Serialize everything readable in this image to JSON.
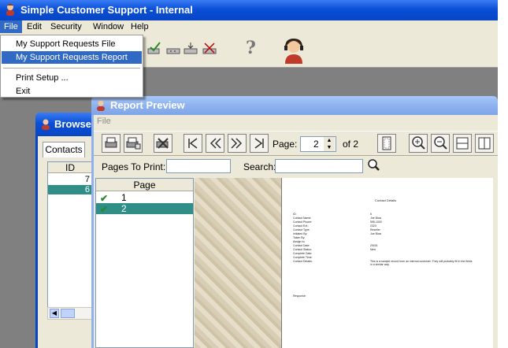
{
  "main_window": {
    "title": "Simple Customer Support - Internal"
  },
  "menubar": {
    "items": [
      "File",
      "Edit",
      "Security",
      "Window",
      "Help"
    ]
  },
  "file_menu": {
    "items": [
      "My Support Requests File",
      "My Support Requests Report",
      "Print Setup ...",
      "Exit"
    ],
    "selected": "My Support Requests Report"
  },
  "toolbar": {
    "help_glyph": "?"
  },
  "browse_window": {
    "title": "Browse",
    "tab": "Contacts",
    "column_header": "ID",
    "rows": [
      "7",
      "6"
    ],
    "selected_row": "6"
  },
  "report_preview": {
    "title": "Report Preview",
    "menu": [
      "File"
    ],
    "page_label": "Page:",
    "page_value": "2",
    "of_label": "of 2",
    "pages_to_print_label": "Pages To Print:",
    "search_label": "Search:",
    "pages_header": "Page",
    "pages": [
      "1",
      "2"
    ],
    "selected_page": "2",
    "report": {
      "heading": "Contact Details",
      "fields": [
        {
          "label": "ID:",
          "value": "6"
        },
        {
          "label": "Contact Name:",
          "value": "Joe Blow"
        },
        {
          "label": "Contact Phone:",
          "value": "555-1000"
        },
        {
          "label": "Contact Ext.:",
          "value": "2323"
        },
        {
          "label": "Contact Type:",
          "value": "Reseller"
        },
        {
          "label": "Initiated By:",
          "value": "Joe Blow"
        },
        {
          "label": "Taken By:",
          "value": ""
        },
        {
          "label": "Assign to:",
          "value": ""
        },
        {
          "label": "Contact Date:",
          "value": "2/5/01"
        },
        {
          "label": "Contact Status:",
          "value": "New"
        },
        {
          "label": "Complete Date:",
          "value": ""
        },
        {
          "label": "Complete Time:",
          "value": ""
        },
        {
          "label": "Contact Details:",
          "value": "This is a sample record from an internal customer. They will probably fill in the fields in a similar way."
        }
      ],
      "response_label": "Response:"
    }
  },
  "colors": {
    "titlebar": "#0a4fd6",
    "selection": "#316ac5",
    "page_selection": "#2f8f86"
  }
}
